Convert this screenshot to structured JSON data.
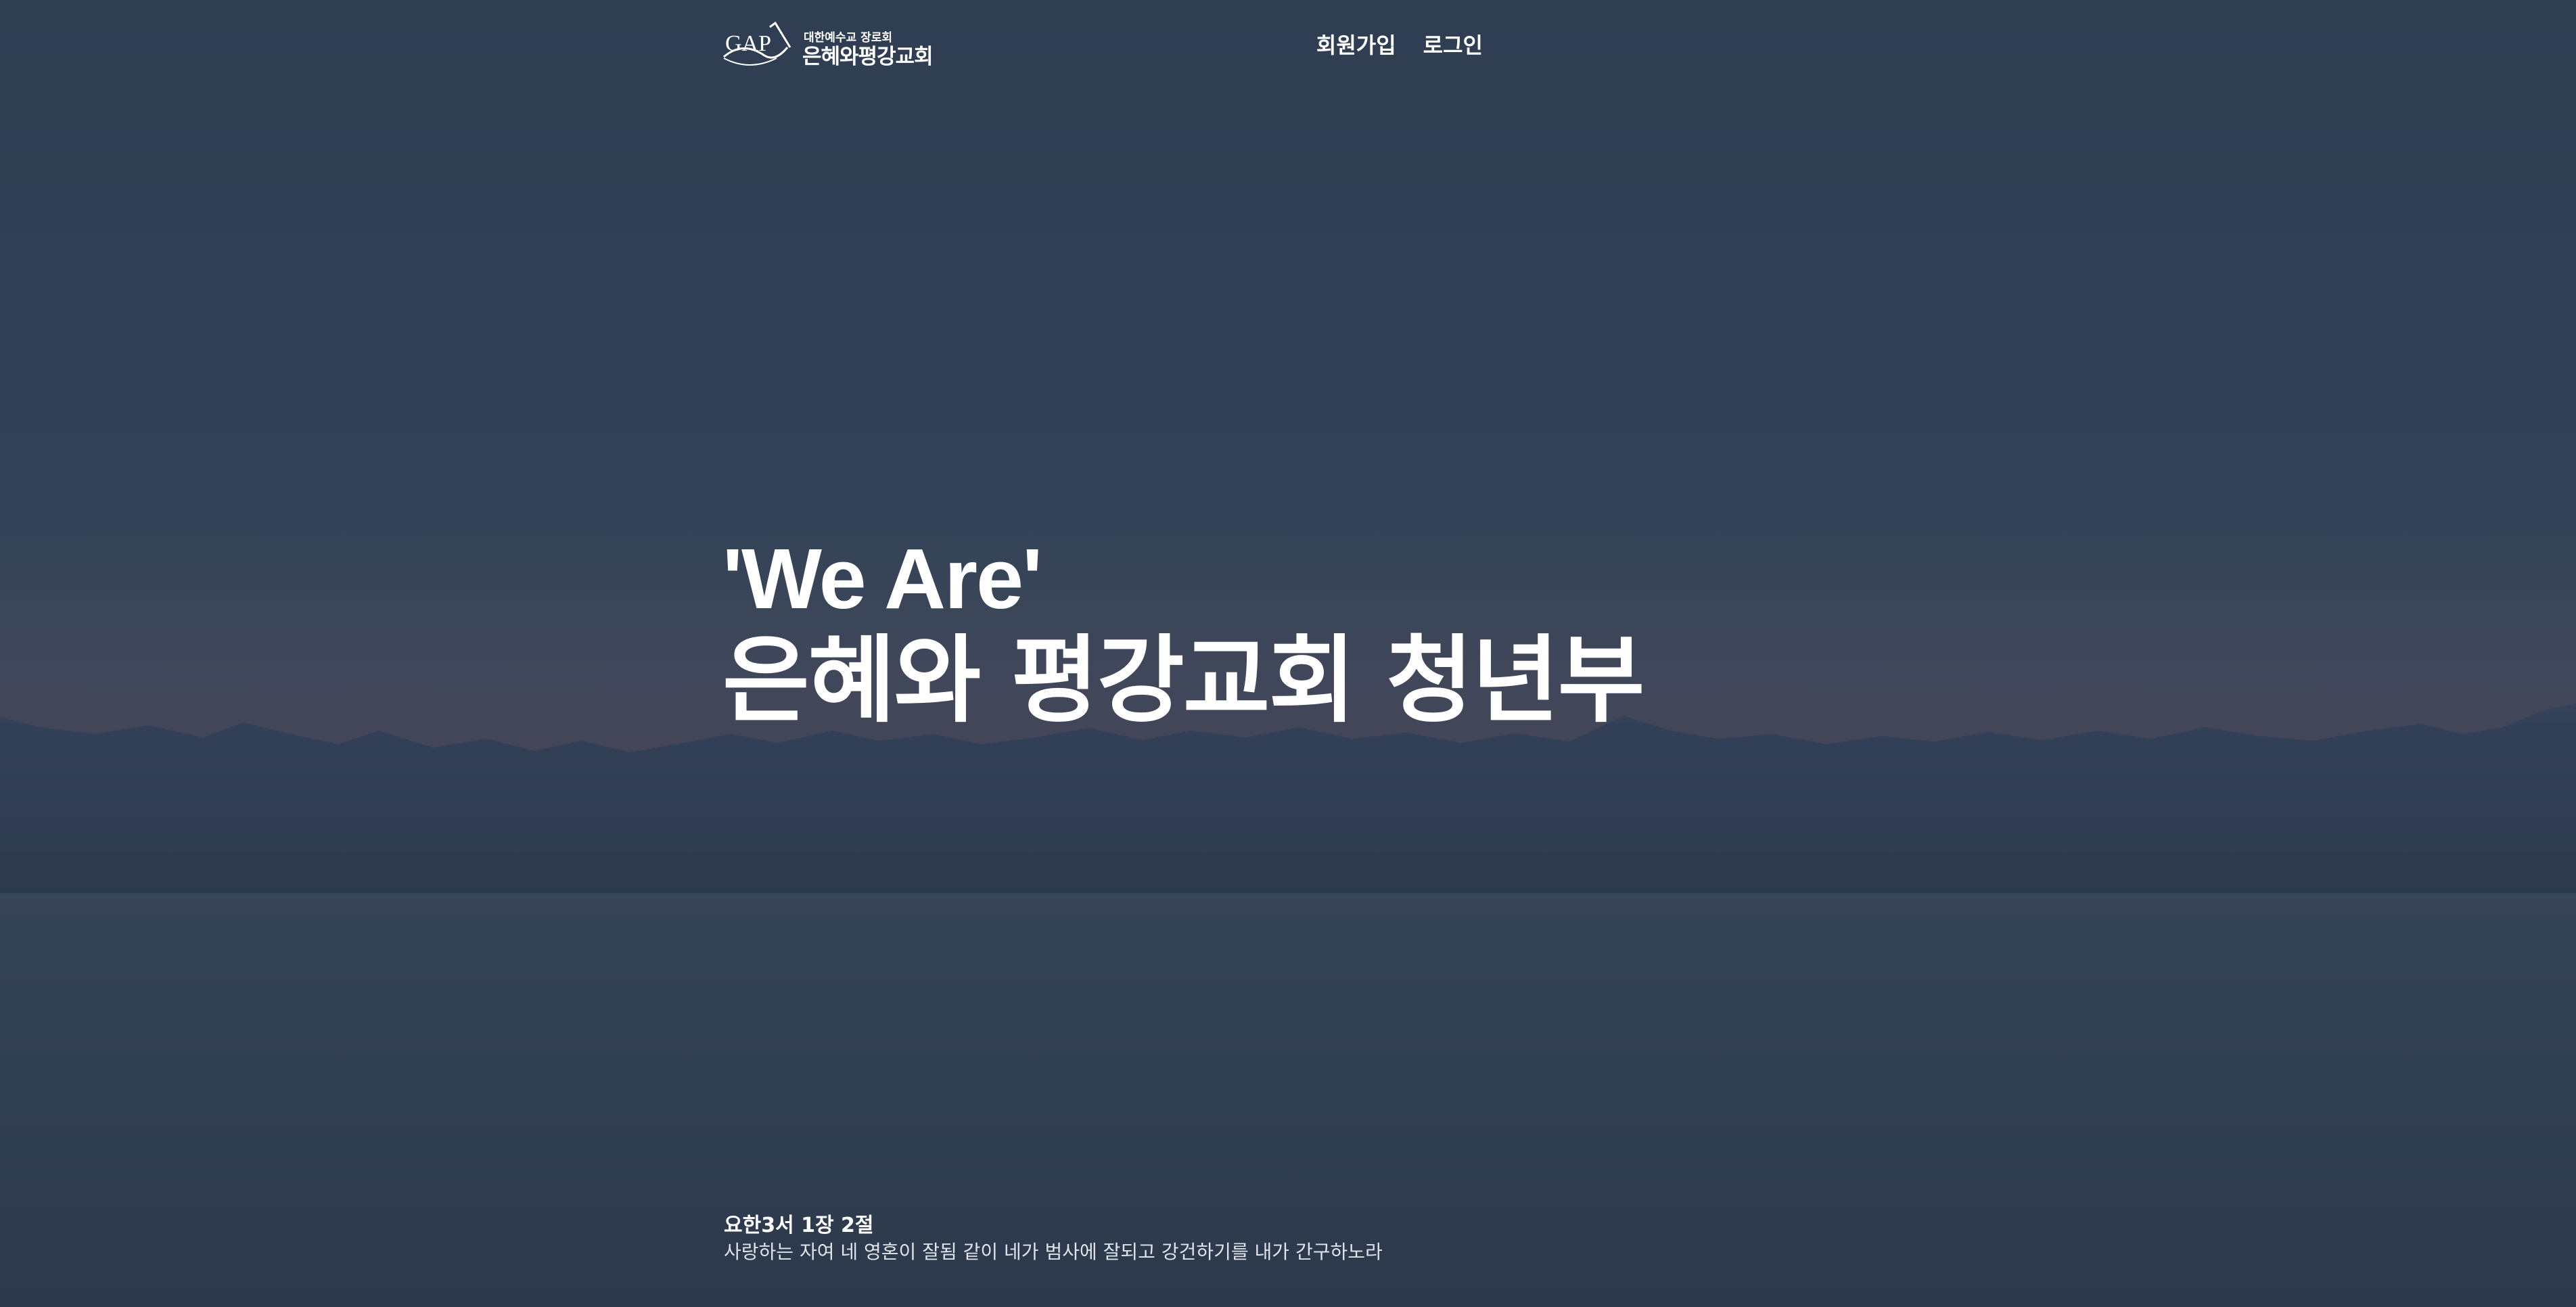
{
  "header": {
    "logo": {
      "mark_text": "GAP",
      "subtitle": "대한예수교 장로회",
      "title": "은혜와평강교회"
    },
    "nav": {
      "signup_label": "회원가입",
      "login_label": "로그인"
    }
  },
  "hero": {
    "line1": "'We Are'",
    "line2": "은혜와 평강교회 청년부"
  },
  "verse": {
    "reference": "요한3서 1장 2절",
    "text": "사랑하는 자여 네 영혼이 잘됨 같이 네가 범사에 잘되고 강건하기를 내가 간구하노라"
  },
  "colors": {
    "background": "#324257",
    "mountain": "#2f3d50",
    "text": "#ffffff"
  }
}
